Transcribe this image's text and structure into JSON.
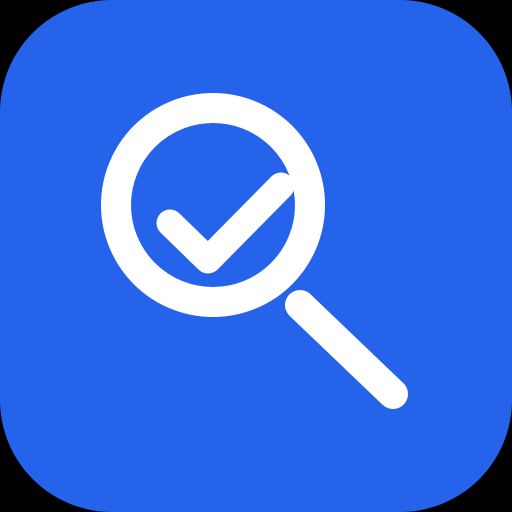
{
  "app_icon": {
    "icon_name": "search-check-icon",
    "symbol_icon": "magnifying-glass-icon",
    "badge_icon": "checkmark-icon",
    "colors": {
      "background": "#000000",
      "tile": "#2563EB",
      "symbol": "#FFFFFF"
    }
  }
}
